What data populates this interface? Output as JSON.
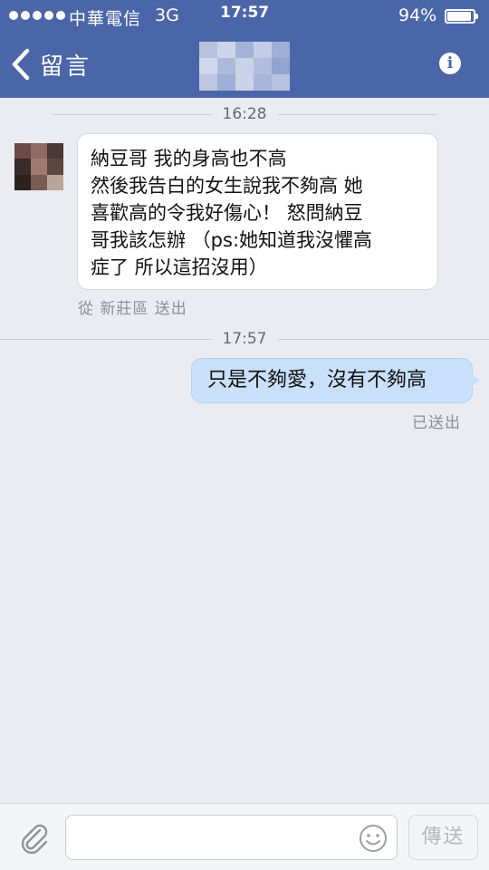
{
  "status_bar": {
    "carrier": "中華電信",
    "network": "3G",
    "time": "17:57",
    "battery": "94%"
  },
  "nav": {
    "back_label": "留言",
    "info_label": "i"
  },
  "messages": {
    "divider_1": "16:28",
    "incoming": {
      "lines": [
        "納豆哥  我的身高也不高",
        "然後我告白的女生說我不夠高 她",
        "喜歡高的令我好傷心！ 怒問納豆",
        "哥我該怎辦 （ps:她知道我沒懼高",
        "症了 所以這招沒用）"
      ],
      "meta": "從 新莊區 送出"
    },
    "divider_2": "17:57",
    "outgoing": {
      "text": "只是不夠愛，沒有不夠高",
      "meta": "已送出"
    }
  },
  "composer": {
    "placeholder": "",
    "send_label": "傳送"
  },
  "colors": {
    "header": "#4b66a8",
    "background": "#eaecf2",
    "outgoing_bubble": "#c9e0fa",
    "incoming_bubble": "#ffffff"
  },
  "icons": {
    "back": "chevron-left-icon",
    "info": "info-icon",
    "attach": "paperclip-icon",
    "emoji": "smiley-icon"
  }
}
